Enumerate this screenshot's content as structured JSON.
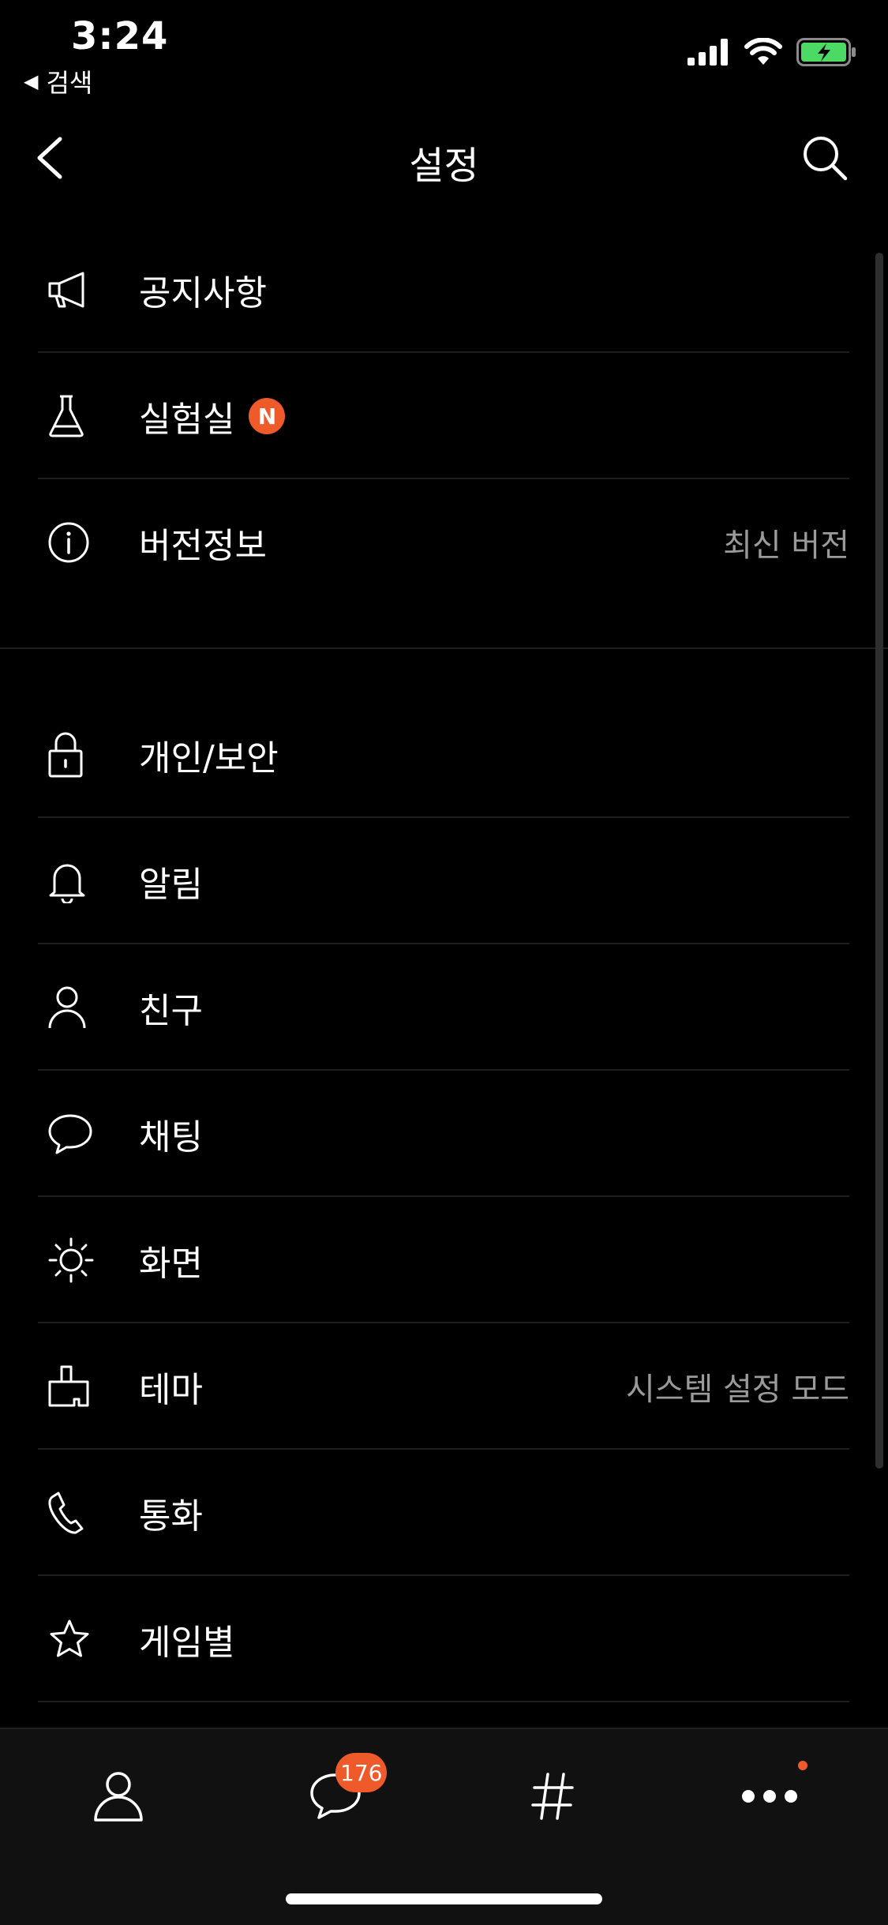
{
  "status_bar": {
    "time": "3:24",
    "back_label": "검색",
    "icons": [
      "cellular-signal-icon",
      "wifi-icon",
      "battery-charging-icon"
    ],
    "battery_color": "#4cd964"
  },
  "header": {
    "title": "설정",
    "back_icon": "chevron-left-icon",
    "search_icon": "search-icon"
  },
  "menu_group_1": [
    {
      "label": "공지사항",
      "icon": "megaphone-icon"
    },
    {
      "label": "실험실",
      "icon": "flask-icon",
      "badge": "N"
    },
    {
      "label": "버전정보",
      "icon": "info-icon",
      "value": "최신 버전"
    }
  ],
  "menu_group_2": [
    {
      "label": "개인/보안",
      "icon": "lock-icon"
    },
    {
      "label": "알림",
      "icon": "bell-icon"
    },
    {
      "label": "친구",
      "icon": "person-icon"
    },
    {
      "label": "채팅",
      "icon": "chat-bubble-icon"
    },
    {
      "label": "화면",
      "icon": "brightness-icon"
    },
    {
      "label": "테마",
      "icon": "paint-brush-icon",
      "value": "시스템 설정 모드"
    },
    {
      "label": "통화",
      "icon": "phone-icon"
    },
    {
      "label": "게임별",
      "icon": "star-icon"
    }
  ],
  "tab_bar": {
    "tabs": [
      {
        "name": "friends",
        "icon": "person-icon"
      },
      {
        "name": "chats",
        "icon": "chat-bubble-icon",
        "badge": "176"
      },
      {
        "name": "view",
        "icon": "hashtag-icon"
      },
      {
        "name": "more",
        "icon": "more-dots-icon",
        "dot": true
      }
    ]
  },
  "colors": {
    "accent": "#ee5a2a",
    "background": "#000000",
    "secondary_text": "#9a9a9a"
  }
}
